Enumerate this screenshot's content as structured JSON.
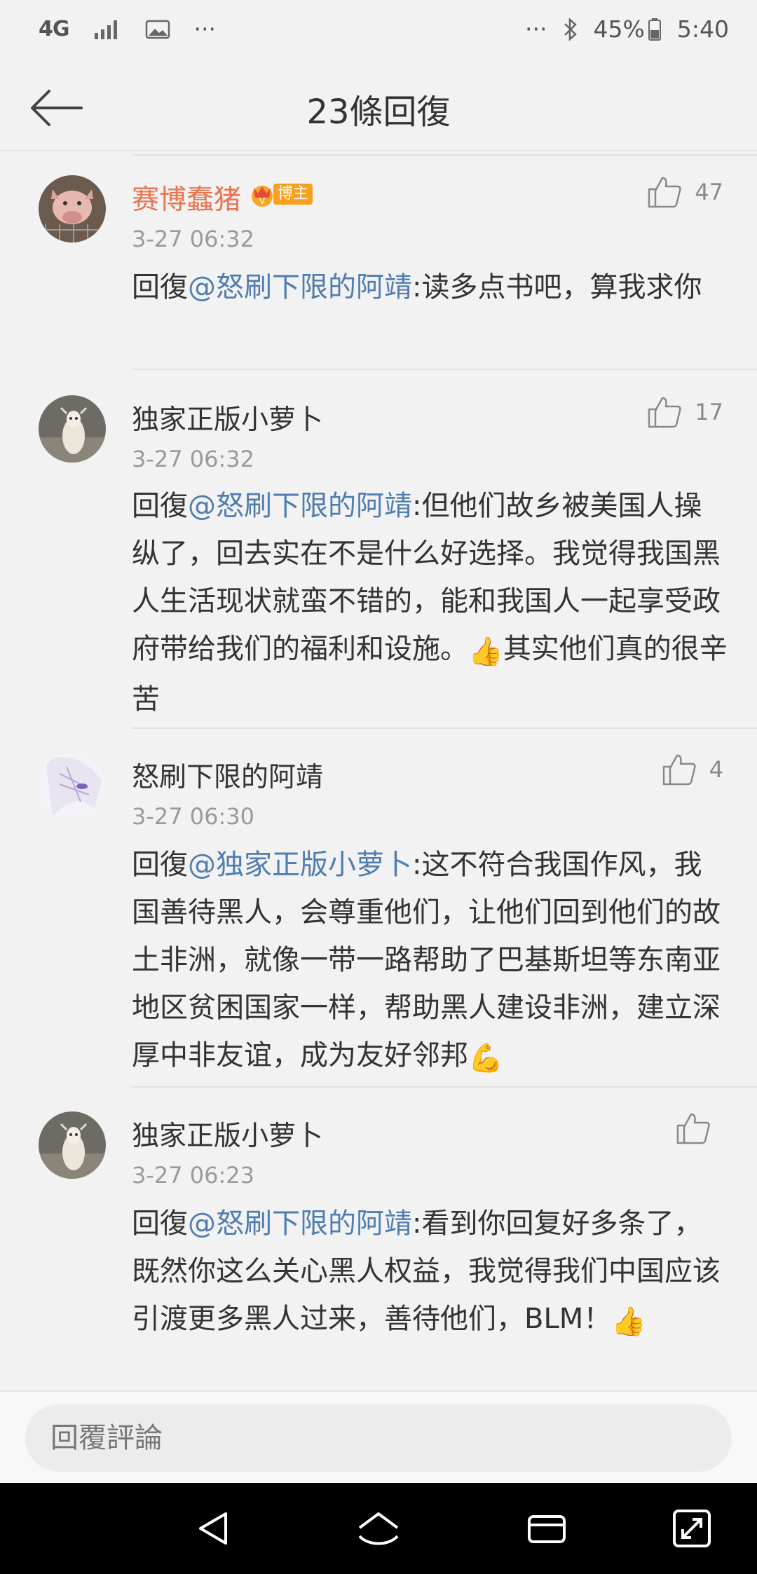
{
  "status_bar": {
    "network": "4G",
    "dots_left": "···",
    "dots_right": "···",
    "battery": "45%",
    "time": "5:40"
  },
  "header": {
    "title": "23條回復"
  },
  "comments": [
    {
      "name": "赛博蠢猪",
      "badge": "博主",
      "time": "3-27 06:32",
      "reply_prefix": "回復",
      "mention": "@怒刷下限的阿靖",
      "body": ":读多点书吧，算我求你",
      "likes": "47"
    },
    {
      "name": "独家正版小萝卜",
      "time": "3-27 06:32",
      "reply_prefix": "回復",
      "mention": "@怒刷下限的阿靖",
      "body": ":但他们故乡被美国人操纵了，回去实在不是什么好选择。我觉得我国黑人生活现状就蛮不错的，能和我国人一起享受政府带给我们的福利和设施。",
      "emoji": "👍",
      "body_tail": "其实他们真的很辛苦",
      "likes": "17"
    },
    {
      "name": "怒刷下限的阿靖",
      "time": "3-27 06:30",
      "reply_prefix": "回復",
      "mention": "@独家正版小萝卜",
      "body": ":这不符合我国作风，我国善待黑人，会尊重他们，让他们回到他们的故土非洲，就像一带一路帮助了巴基斯坦等东南亚地区贫困国家一样，帮助黑人建设非洲，建立深厚中非友谊，成为友好邻邦",
      "emoji": "💪",
      "likes": "4"
    },
    {
      "name": "独家正版小萝卜",
      "time": "3-27 06:23",
      "reply_prefix": "回復",
      "mention": "@怒刷下限的阿靖",
      "body": ":看到你回复好多条了，既然你这么关心黑人权益，我觉得我们中国应该引渡更多黑人过来，善待他们，BLM！",
      "emoji": "👍",
      "likes": ""
    }
  ],
  "reply_bar": {
    "placeholder": "回覆評論"
  },
  "icons": {
    "back": "arrow-left-icon",
    "like": "thumbs-up-icon",
    "nav_back": "triangle-back-icon",
    "nav_home": "home-icon",
    "nav_recents": "recents-icon",
    "nav_expand": "expand-icon"
  },
  "colors": {
    "vip_name": "#eb7350",
    "mention": "#507daf",
    "badge": "#f7a020"
  }
}
